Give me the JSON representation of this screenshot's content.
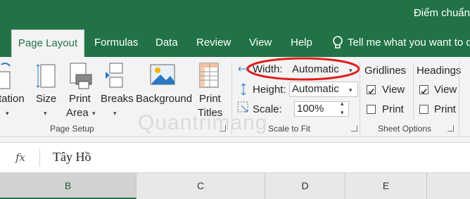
{
  "window": {
    "title": "Điểm chuẩn"
  },
  "tabs": [
    "Page Layout",
    "Formulas",
    "Data",
    "Review",
    "View",
    "Help"
  ],
  "tell_me": "Tell me what you want to d",
  "page_setup": {
    "orientation": "tation",
    "size": "Size",
    "print_area_1": "Print",
    "print_area_2": "Area",
    "breaks": "Breaks",
    "background": "Background",
    "print_titles_1": "Print",
    "print_titles_2": "Titles",
    "group_label": "Page Setup"
  },
  "scale_to_fit": {
    "width_label": "Width:",
    "width_value": "Automatic",
    "height_label": "Height:",
    "height_value": "Automatic",
    "scale_label": "Scale:",
    "scale_value": "100%",
    "group_label": "Scale to Fit"
  },
  "sheet_options": {
    "gridlines": "Gridlines",
    "headings": "Headings",
    "view": "View",
    "print": "Print",
    "group_label": "Sheet Options",
    "gridlines_view_checked": true,
    "gridlines_print_checked": false,
    "headings_view_checked": true,
    "headings_print_checked": false
  },
  "formula_bar": {
    "fx": "fx",
    "value": "Tây Hồ"
  },
  "columns": [
    "B",
    "C",
    "D",
    "E"
  ],
  "watermark": "Quantrimang",
  "colors": {
    "brand": "#217346",
    "highlight": "#e01e1e"
  }
}
